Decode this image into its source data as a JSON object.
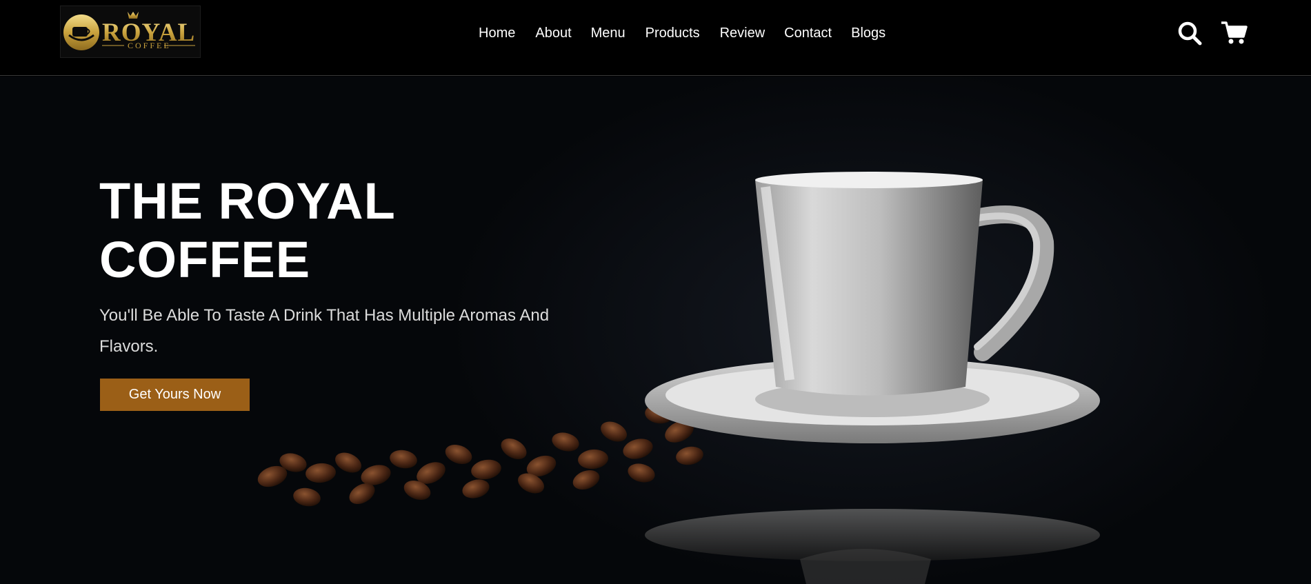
{
  "header": {
    "logo": {
      "brand_word": "ROYAL",
      "brand_sub": "COFFEE"
    },
    "nav": [
      {
        "label": "Home"
      },
      {
        "label": "About"
      },
      {
        "label": "Menu"
      },
      {
        "label": "Products"
      },
      {
        "label": "Review"
      },
      {
        "label": "Contact"
      },
      {
        "label": "Blogs"
      }
    ],
    "icons": [
      "search-icon",
      "cart-icon"
    ]
  },
  "hero": {
    "title": "THE ROYAL\nCOFFEE",
    "subtitle": "You'll Be Able To Taste A Drink That Has Multiple Aromas And Flavors.",
    "cta_label": "Get Yours Now",
    "image": "coffee-cup-with-beans"
  },
  "colors": {
    "background": "#000000",
    "accent": "#9b5f17",
    "logo_gold": "#d4b24c",
    "text": "#ffffff"
  }
}
